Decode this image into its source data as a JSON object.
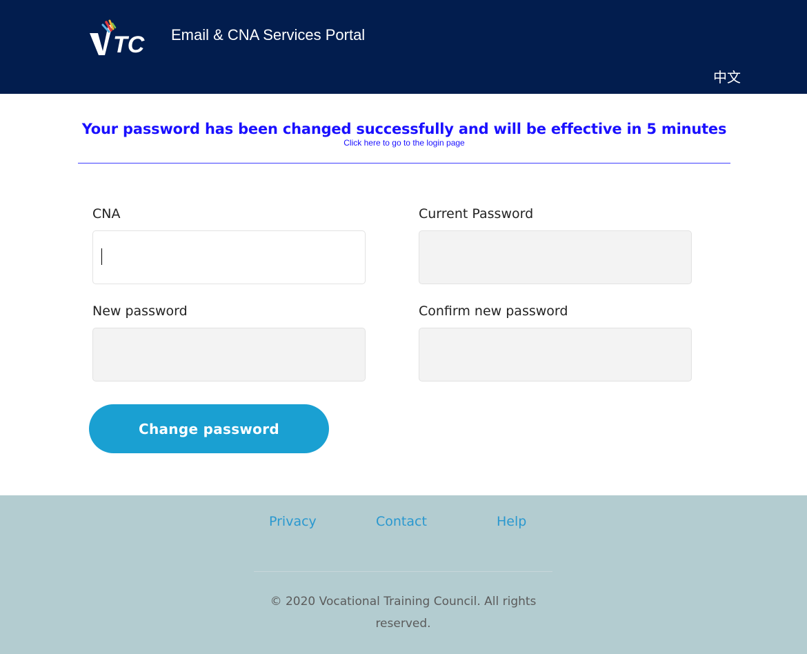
{
  "header": {
    "logo_text": "VTC",
    "title": "Email & CNA Services Portal",
    "language_toggle": "中文",
    "colors": {
      "background": "#021d4e",
      "text": "#ffffff"
    }
  },
  "message": {
    "success": "Your password has been changed successfully and will be effective in 5 minutes",
    "login_link": "Click here to go to the login page",
    "color": "#1a10ff"
  },
  "form": {
    "cna": {
      "label": "CNA",
      "value": "",
      "focused": true
    },
    "current_password": {
      "label": "Current Password",
      "value": ""
    },
    "new_password": {
      "label": "New password",
      "value": ""
    },
    "confirm_password": {
      "label": "Confirm new password",
      "value": ""
    },
    "submit_label": "Change password",
    "button_color": "#1aa0d2"
  },
  "footer": {
    "links": [
      "Privacy",
      "Contact",
      "Help"
    ],
    "copyright": "© 2020 Vocational Training Council. All rights reserved.",
    "background": "#b3ccd0",
    "link_color": "#2a98cf"
  }
}
